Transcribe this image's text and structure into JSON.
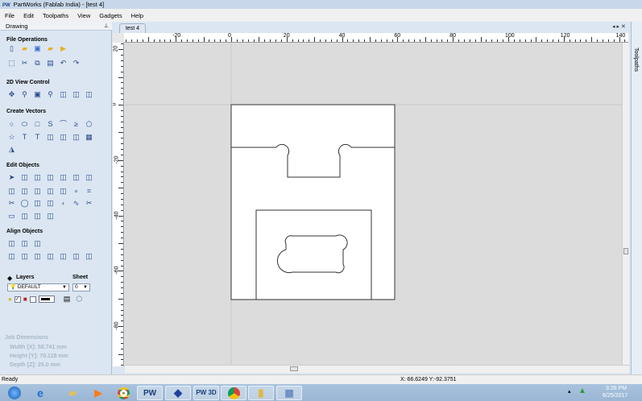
{
  "window": {
    "app_badge": "PW",
    "title": "PartWorks (Fablab India) - [test 4]"
  },
  "menu": [
    "File",
    "Edit",
    "Toolpaths",
    "View",
    "Gadgets",
    "Help"
  ],
  "panel": {
    "title": "Drawing",
    "pin_icon": "pin-icon"
  },
  "sections": {
    "file_operations": {
      "title": "File Operations",
      "rows": [
        [
          "new-file",
          "open-folder",
          "save",
          "open-folder-2",
          "import"
        ],
        [
          "select-box",
          "cut",
          "copy",
          "paste",
          "undo",
          "redo"
        ]
      ]
    },
    "view_control": {
      "title": "2D View Control",
      "rows": [
        [
          "pan",
          "zoom-in",
          "zoom-fit",
          "zoom-out",
          "view-split",
          "view-layout",
          "view-export"
        ]
      ]
    },
    "create_vectors": {
      "title": "Create Vectors",
      "rows": [
        [
          "circle",
          "ellipse",
          "rectangle",
          "polyline",
          "arc",
          "curve",
          "polygon"
        ],
        [
          "star",
          "text",
          "text-on-curve",
          "dimension",
          "text-box",
          "trace",
          "array"
        ],
        [
          "mirror"
        ]
      ]
    },
    "edit_objects": {
      "title": "Edit Objects",
      "rows": [
        [
          "select",
          "node-edit",
          "transform",
          "group",
          "ungroup",
          "join",
          "distort"
        ],
        [
          "scale",
          "size",
          "move",
          "rotate",
          "align-grid",
          "nodes",
          "weld"
        ],
        [
          "trim",
          "offset",
          "fillet",
          "smooth",
          "corner",
          "spline",
          "cut-scissors"
        ],
        [
          "close-vectors",
          "bracket-1",
          "bracket-2",
          "bracket-3"
        ]
      ]
    },
    "align_objects": {
      "title": "Align Objects",
      "rows": [
        [
          "align-center",
          "align-h-center",
          "align-v-center"
        ],
        [
          "align-page",
          "align-left",
          "align-right",
          "align-top",
          "align-bottom",
          "center-h",
          "center-v"
        ]
      ]
    }
  },
  "layers": {
    "title": "Layers",
    "selected": "DEFAULT",
    "sheet_title": "Sheet",
    "sheet_value": "0"
  },
  "job": {
    "title": "Job Dimensions",
    "width": "Width  [X]: 58.741 mm",
    "height": "Height [Y]: 70.118 mm",
    "depth": "Depth  [Z]: 25.0 mm"
  },
  "document_tab": "test 4",
  "right_tab": "Toolpaths",
  "ruler": {
    "h_labels": [
      "-20",
      "0",
      "20",
      "40",
      "60",
      "80",
      "100",
      "120",
      "140"
    ],
    "v_labels": [
      "20",
      "0",
      "-20",
      "-40",
      "-60",
      "-80"
    ]
  },
  "status": {
    "left": "Ready",
    "coords": "X: 66.6249 Y:-92.3751"
  },
  "taskbar": {
    "items": [
      "start",
      "internet-explorer",
      "file-explorer",
      "media-player",
      "chrome",
      "PW",
      "vcarve",
      "PW 3D",
      "chrome-2",
      "folder",
      "app"
    ],
    "time": "3:28 PM",
    "date": "6/25/2017"
  },
  "colors": {
    "panel": "#dbe6f2",
    "canvas": "#dcdcdc",
    "vector": "#333333"
  }
}
